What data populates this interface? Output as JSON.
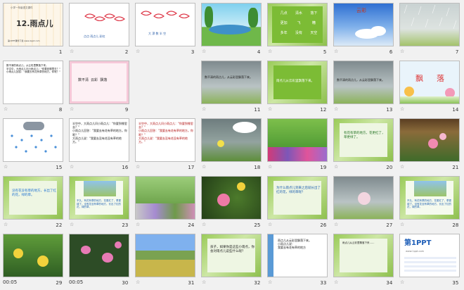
{
  "slides": [
    {
      "n": "1",
      "title": "12.雨点儿",
      "sub": "小学一年级语文课件",
      "footer": "第1PPT课件下载 www.1ppt.com"
    },
    {
      "n": "2",
      "labels": "点点 雨点儿 彩虹"
    },
    {
      "n": "3",
      "labels": "大 漂 数 半 空"
    },
    {
      "n": "4"
    },
    {
      "n": "5",
      "words": [
        "几点",
        "清水",
        "落下",
        "更加",
        "飞",
        "糟",
        "多年",
        "没有",
        "天空"
      ]
    },
    {
      "n": "6",
      "word": "云彩"
    },
    {
      "n": "7"
    },
    {
      "n": "8",
      "text": "数不清的雨点儿，从云彩里飘落下来。\n半空中，大雨点儿问小雨点儿：\"你要到哪里去？\"\n小雨点儿回答：\"我要去有花有草的地方。你呢？\""
    },
    {
      "n": "9",
      "words": "数不清  云彩  飘落"
    },
    {
      "n": "11",
      "text": "数不清的雨点儿，从云彩里飘落下来。"
    },
    {
      "n": "12",
      "text": "雨点儿从云彩里飘落下来。"
    },
    {
      "n": "13",
      "text": "数不清的雨点儿，从云彩里飘落下来。"
    },
    {
      "n": "14",
      "chars": "飘  落"
    },
    {
      "n": "15"
    },
    {
      "n": "16",
      "text": "半空中，大雨点儿问小雨点儿：\"你要到哪里去？\"\n小雨点儿回答：\"我要去有花有草的地方。你呢？\"\n大雨点儿说：\"我要去没有花没有草的地方。\""
    },
    {
      "n": "17",
      "text": "半空中，大雨点儿问小雨点儿：\"你要到哪里去？\"\n小雨点儿回答：\"我要去有花有草的地方。你呢？\"\n大雨点儿说：\"我要去没有花没有草的地方。\""
    },
    {
      "n": "18"
    },
    {
      "n": "19"
    },
    {
      "n": "20",
      "text": "有花有草的地方，花更红了，草更绿了。"
    },
    {
      "n": "21"
    },
    {
      "n": "22",
      "text": "没有花没有草的地方，长出了红的花，绿的草。"
    },
    {
      "n": "23",
      "text": "不久，有花有草的地方，花更红了，草更绿了。没有花没有草的地方，长出了红的花，绿的草。"
    },
    {
      "n": "24"
    },
    {
      "n": "25"
    },
    {
      "n": "26",
      "text": "为什么雨点儿到来之后就长出了红的花，绿的草呢？"
    },
    {
      "n": "27"
    },
    {
      "n": "28",
      "text": "不久，有花有草的地方，花更红了，草更绿了。没有花没有草的地方，长出了红的花，绿的草。"
    },
    {
      "n": "29",
      "dur": "00:05"
    },
    {
      "n": "30",
      "dur": "00:05"
    },
    {
      "n": "31"
    },
    {
      "n": "32",
      "text": "孩子，如果你是这些小雨点，你会对雨点儿说些什么呢？"
    },
    {
      "n": "33",
      "text": "雨点儿从云彩里飘落下来。\n小雨点儿说：\n我要去有花有草的地方"
    },
    {
      "n": "34",
      "text": "雨点儿从云彩里飘落下来……"
    },
    {
      "n": "35",
      "brand": "第1PPT",
      "url": "www.1ppt.com"
    }
  ],
  "star": "☆"
}
